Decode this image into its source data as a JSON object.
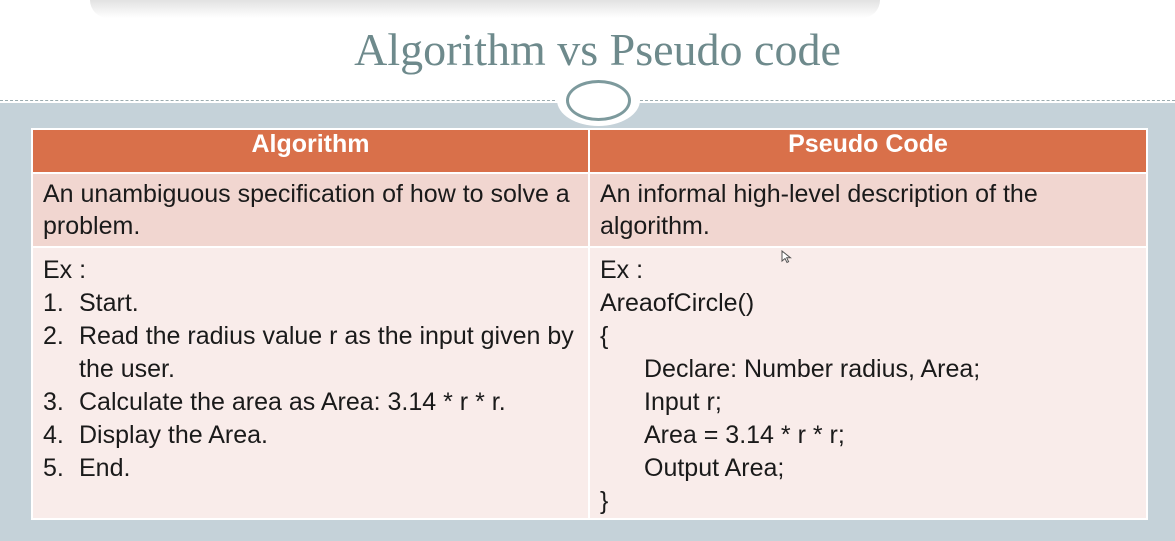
{
  "slide": {
    "title": "Algorithm vs Pseudo code"
  },
  "table": {
    "headers": [
      "Algorithm",
      "Pseudo Code"
    ],
    "definitions": [
      "An unambiguous specification of how to solve a problem.",
      "An informal high-level description of the algorithm."
    ],
    "algorithm_example": {
      "label": "Ex :",
      "steps": [
        {
          "num": "1.",
          "text": "Start."
        },
        {
          "num": "2.",
          "text": "Read the radius value r as the input given by the user."
        },
        {
          "num": "3.",
          "text": "Calculate the area as Area: 3.14 * r * r."
        },
        {
          "num": "4.",
          "text": "Display the Area."
        },
        {
          "num": "5.",
          "text": "End."
        }
      ]
    },
    "pseudo_example": {
      "label": "Ex :",
      "lines": [
        "AreaofCircle()",
        "{",
        "Declare: Number radius, Area;",
        "Input r;",
        "Area = 3.14 * r * r;",
        "Output Area;",
        "}"
      ]
    }
  },
  "colors": {
    "header_fill": "#d9704a",
    "definition_fill": "#f1d6d0",
    "example_fill": "#f9ecea",
    "title_color": "#6e8a8c",
    "background": "#c5d2d9"
  },
  "icons": {
    "cursor": "mouse-pointer-icon",
    "ornament": "ellipse-ornament"
  }
}
